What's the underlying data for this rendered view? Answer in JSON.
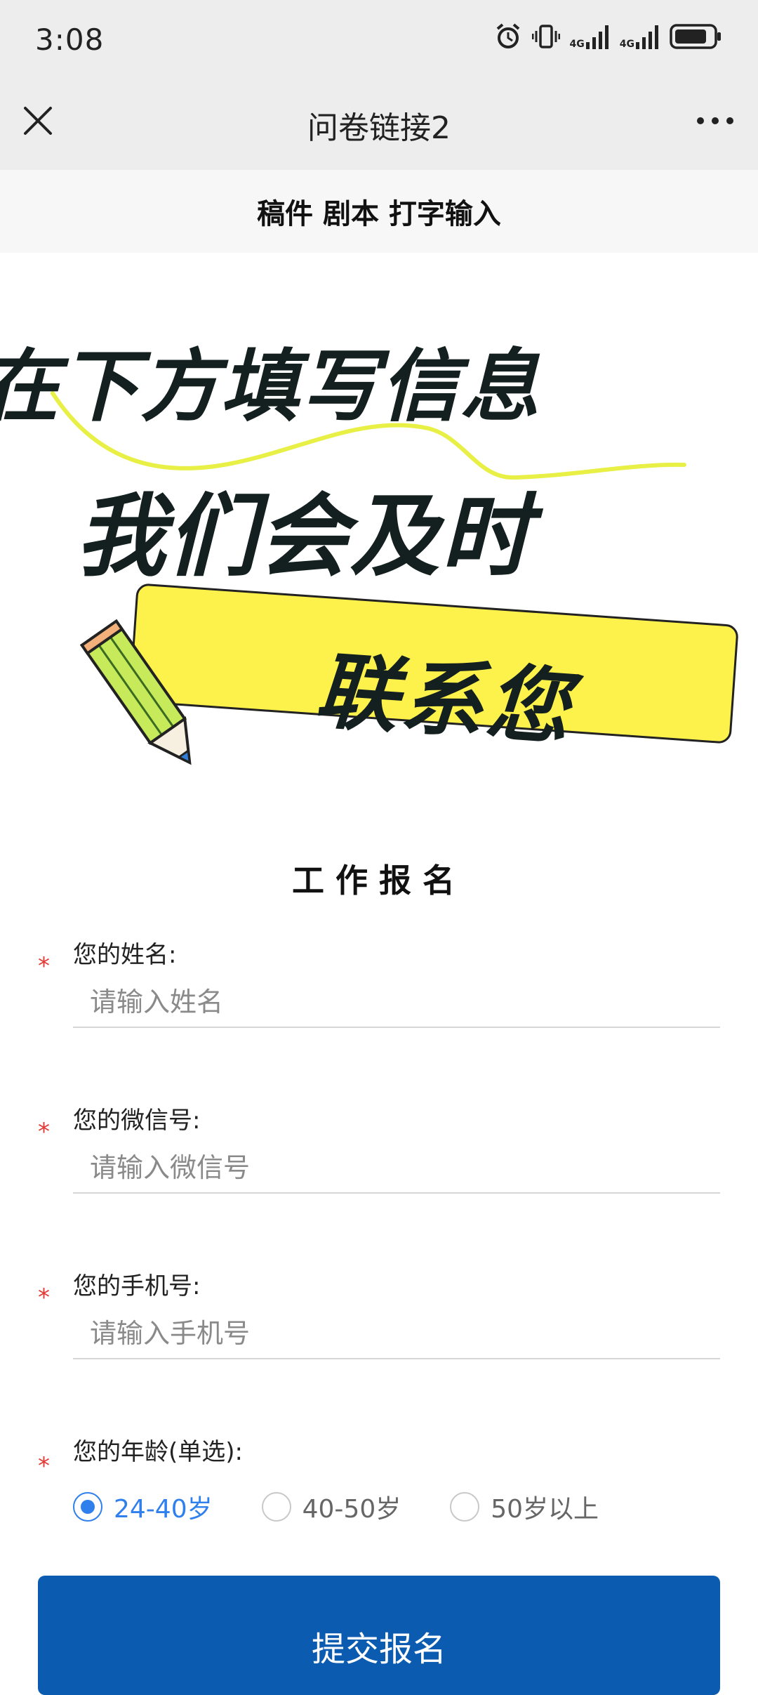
{
  "status_bar": {
    "time": "3:08",
    "network_1": "4G",
    "network_2": "4G",
    "icons": [
      "alarm-icon",
      "vibrate-icon",
      "signal-icon",
      "signal-icon",
      "battery-icon"
    ]
  },
  "nav": {
    "title": "问卷链接2",
    "close_icon": "close-icon",
    "more_icon": "more-icon"
  },
  "sub_header": {
    "text": "稿件 剧本 打字输入"
  },
  "banner": {
    "line1": "在下方填写信息",
    "line2": "我们会及时",
    "tag": "联系您",
    "accent_color": "#fdf24c"
  },
  "form": {
    "title": "工作报名",
    "required_mark": "*",
    "fields": [
      {
        "label": "您的姓名:",
        "placeholder": "请输入姓名",
        "value": ""
      },
      {
        "label": "您的微信号:",
        "placeholder": "请输入微信号",
        "value": ""
      },
      {
        "label": "您的手机号:",
        "placeholder": "请输入手机号",
        "value": ""
      }
    ],
    "age": {
      "label": "您的年龄(单选):",
      "options": [
        "24-40岁",
        "40-50岁",
        "50岁以上"
      ],
      "selected": "24-40岁"
    },
    "submit_label": "提交报名",
    "submit_color": "#0b5bb1"
  }
}
